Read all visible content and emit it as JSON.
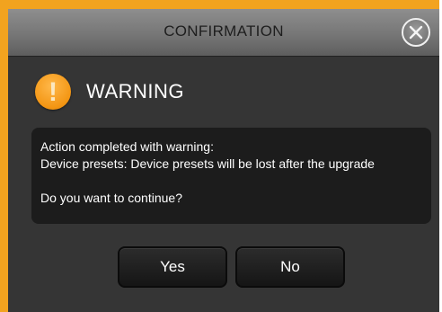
{
  "dialog": {
    "title": "CONFIRMATION",
    "close_icon": "close-circle-x-icon",
    "accent_color": "#f2a31f"
  },
  "warning": {
    "icon": "exclamation-circle-icon",
    "icon_glyph": "!",
    "title": "WARNING"
  },
  "message": {
    "line1": "Action completed with warning:",
    "line2": "Device presets: Device presets will be lost after the upgrade",
    "line3": "Do you want to continue?"
  },
  "buttons": {
    "yes_label": "Yes",
    "no_label": "No"
  }
}
